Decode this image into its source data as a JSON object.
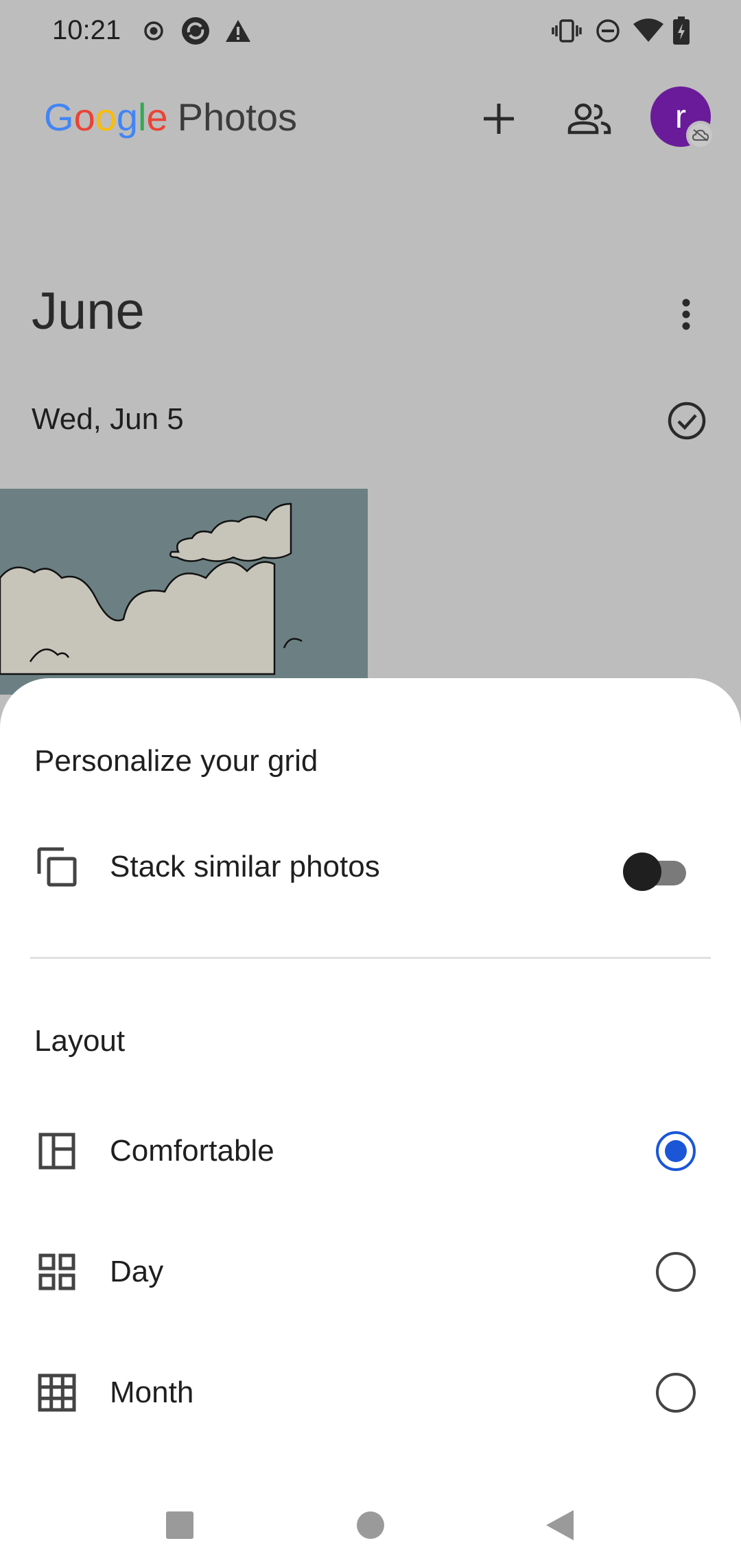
{
  "status_bar": {
    "time": "10:21",
    "left_icons": [
      "record-icon",
      "sync-icon",
      "warning-icon"
    ],
    "right_icons": [
      "vibrate-icon",
      "do-not-disturb-icon",
      "wifi-icon",
      "battery-charging-icon"
    ]
  },
  "app_bar": {
    "logo_letters": [
      "G",
      "o",
      "o",
      "g",
      "l",
      "e"
    ],
    "logo_suffix": "Photos",
    "add_icon": "plus-icon",
    "sharing_icon": "people-icon",
    "avatar_letter": "r",
    "avatar_badge_icon": "cloud-off-icon"
  },
  "content": {
    "month_title": "June",
    "date_label": "Wed, Jun 5"
  },
  "sheet": {
    "title": "Personalize your grid",
    "stack_row": {
      "label": "Stack similar photos",
      "icon": "stack-icon",
      "enabled": false
    },
    "layout_section_label": "Layout",
    "layout_options": [
      {
        "label": "Comfortable",
        "icon": "comfortable-layout-icon",
        "selected": true
      },
      {
        "label": "Day",
        "icon": "day-grid-icon",
        "selected": false
      },
      {
        "label": "Month",
        "icon": "month-grid-icon",
        "selected": false
      }
    ]
  },
  "nav_bar": {
    "buttons": [
      "recents-icon",
      "home-icon",
      "back-icon"
    ]
  },
  "colors": {
    "scrim_background": "#bdbdbd",
    "accent": "#1a56d6",
    "avatar": "#6a1b9a",
    "sheet_background": "#ffffff"
  }
}
